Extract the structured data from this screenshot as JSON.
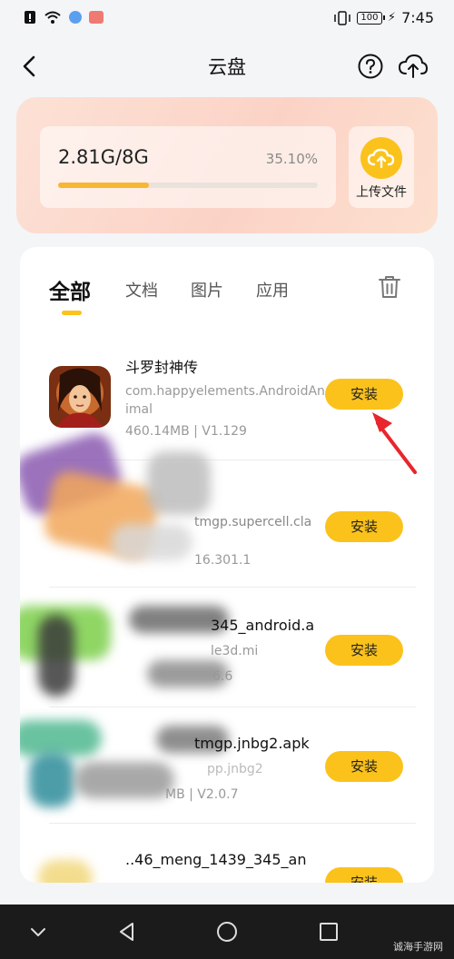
{
  "status": {
    "battery": "100",
    "time": "7:45"
  },
  "header": {
    "title": "云盘"
  },
  "storage": {
    "usage": "2.81G/8G",
    "percent": "35.10%",
    "progress": 0.351,
    "upload_label": "上传文件"
  },
  "tabs": [
    {
      "label": "全部",
      "active": true
    },
    {
      "label": "文档"
    },
    {
      "label": "图片"
    },
    {
      "label": "应用"
    }
  ],
  "apps": [
    {
      "name": "斗罗封神传",
      "package": "com.happyelements.AndroidAnimal",
      "meta": "460.14MB | V1.129",
      "install": "安装"
    },
    {
      "name": "",
      "package": "tmgp.supercell.cla",
      "meta": "16.301.1",
      "install": "安装"
    },
    {
      "name": "",
      "package": "345_android.a",
      "meta": "le3d.mi",
      "meta2": "6.6",
      "install": "安装"
    },
    {
      "name": "",
      "package": "tmgp.jnbg2.apk",
      "meta": "pp.jnbg2",
      "meta2": "MB | V2.0.7",
      "install": "安装"
    },
    {
      "name": "",
      "package": "..46_meng_1439_345_an",
      "install": "安装"
    }
  ],
  "watermark": "诚海手游网",
  "colors": {
    "accent": "#fbc21c",
    "progress": "#f7b733",
    "card_gradient": "#fbd3c6"
  }
}
